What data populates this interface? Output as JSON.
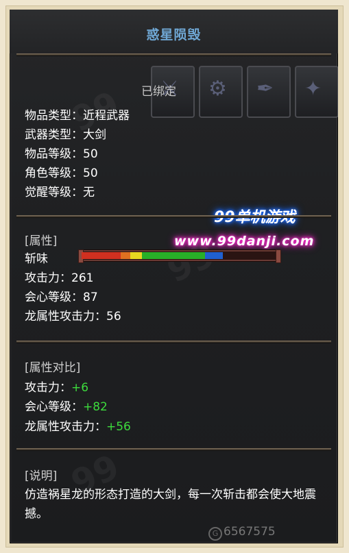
{
  "item": {
    "name": "惑星陨毁",
    "bound": "已绑定",
    "basic": [
      {
        "label": "物品类型：",
        "value": "近程武器"
      },
      {
        "label": "武器类型：",
        "value": "大剑"
      },
      {
        "label": "物品等级：",
        "value": "50"
      },
      {
        "label": "角色等级：",
        "value": "50"
      },
      {
        "label": "觉醒等级：",
        "value": "无"
      }
    ],
    "attributes": {
      "header": "[属性]",
      "sharpness_label": "斩味",
      "sharpness": [
        {
          "color": "#d03020",
          "fraction": 0.2
        },
        {
          "color": "#e07020",
          "fraction": 0.05
        },
        {
          "color": "#e8d820",
          "fraction": 0.06
        },
        {
          "color": "#28b028",
          "fraction": 0.32
        },
        {
          "color": "#2060d0",
          "fraction": 0.09
        }
      ],
      "stats": [
        {
          "label": "攻击力：",
          "value": "261"
        },
        {
          "label": "会心等级：",
          "value": "87"
        },
        {
          "label": "龙属性攻击力：",
          "value": "56"
        }
      ]
    },
    "compare": {
      "header": "[属性对比]",
      "stats": [
        {
          "label": "攻击力：",
          "value": "+6"
        },
        {
          "label": "会心等级：",
          "value": "+82"
        },
        {
          "label": "龙属性攻击力：",
          "value": "+56"
        }
      ]
    },
    "description": {
      "header": "[说明]",
      "text": "仿造祸星龙的形态打造的大剑，每一次斩击都会使大地震撼。"
    },
    "price": "6567575"
  },
  "watermark": {
    "line1": "99单机游戏",
    "line2": "www.99danji.com"
  }
}
